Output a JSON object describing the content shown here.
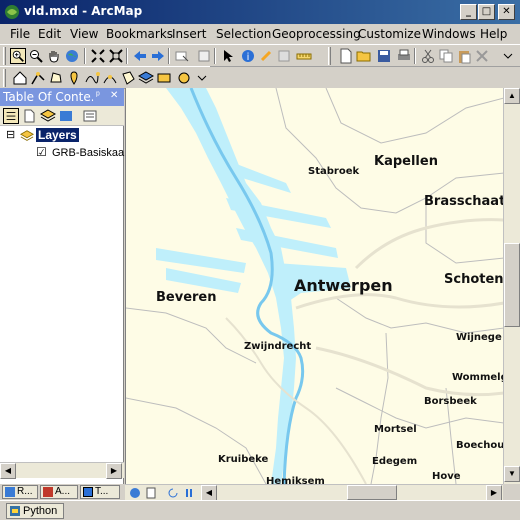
{
  "window": {
    "title": "vld.mxd - ArcMap",
    "minimize": "_",
    "maximize": "□",
    "close": "✕"
  },
  "menu": {
    "items": [
      "File",
      "Edit",
      "View",
      "Bookmarks",
      "Insert",
      "Selection",
      "Geoprocessing",
      "Customize",
      "Windows",
      "Help"
    ]
  },
  "toc": {
    "title": "Table Of Conte...",
    "pin": "ᵖ",
    "close": "✕",
    "root_label": "Layers",
    "root_toggle": "⊟",
    "layer_label": "GRB-Basiskaa",
    "layer_checked": "☑"
  },
  "map": {
    "labels": {
      "antwerpen": "Antwerpen",
      "kapellen": "Kapellen",
      "brasschaat": "Brasschaat",
      "stabroek": "Stabroek",
      "beveren": "Beveren",
      "schoten": "Schoten",
      "zwijndrecht": "Zwijndrecht",
      "wijnegem": "Wijnege",
      "wommelgem": "Wommelg",
      "borsbeek": "Borsbeek",
      "mortsel": "Mortsel",
      "boechout": "Boechou",
      "kruibeke": "Kruibeke",
      "edegem": "Edegem",
      "hove": "Hove",
      "hemiksem": "Hemiksem"
    },
    "colors": {
      "land": "#fefce6",
      "water": "#bfeffb",
      "river": "#97e4f7",
      "boundary": "#bdbdbd",
      "roads": "#e6e2cf"
    }
  },
  "tabs": [
    {
      "label": "R...",
      "icon": "tab-icon-r"
    },
    {
      "label": "A...",
      "icon": "tab-icon-a"
    },
    {
      "label": "T...",
      "icon": "tab-icon-t"
    }
  ],
  "bottom": {
    "python_label": "Python"
  }
}
